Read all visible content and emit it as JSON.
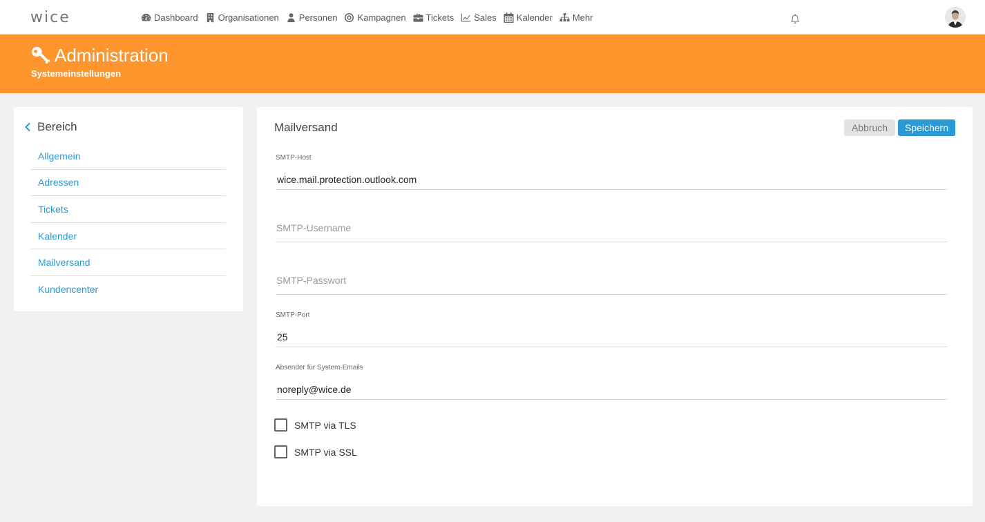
{
  "app": {
    "logo": "wice"
  },
  "nav": [
    {
      "label": "Dashboard",
      "icon": "dashboard-icon"
    },
    {
      "label": "Organisationen",
      "icon": "building-icon"
    },
    {
      "label": "Personen",
      "icon": "person-icon"
    },
    {
      "label": "Kampagnen",
      "icon": "target-icon"
    },
    {
      "label": "Tickets",
      "icon": "briefcase-icon"
    },
    {
      "label": "Sales",
      "icon": "line-chart-icon"
    },
    {
      "label": "Kalender",
      "icon": "calendar-icon"
    },
    {
      "label": "Mehr",
      "icon": "sitemap-icon"
    }
  ],
  "header": {
    "title": "Administration",
    "subtitle": "Systemeinstellungen",
    "icon": "key-icon",
    "color": "#ff952d"
  },
  "sidebar": {
    "heading": "Bereich",
    "items": [
      {
        "label": "Allgemein"
      },
      {
        "label": "Adressen"
      },
      {
        "label": "Tickets"
      },
      {
        "label": "Kalender"
      },
      {
        "label": "Mailversand"
      },
      {
        "label": "Kundencenter"
      }
    ]
  },
  "form": {
    "title": "Mailversand",
    "cancel_label": "Abbruch",
    "save_label": "Speichern",
    "smtp_host": {
      "label": "SMTP-Host",
      "value": "wice.mail.protection.outlook.com"
    },
    "smtp_username": {
      "placeholder": "SMTP-Username"
    },
    "smtp_password": {
      "placeholder": "SMTP-Passwort"
    },
    "smtp_port": {
      "label": "SMTP-Port",
      "value": "25"
    },
    "sender": {
      "label": "Absender für System-Emails",
      "value": "noreply@wice.de"
    },
    "tls": {
      "label": "SMTP via TLS",
      "checked": false
    },
    "ssl": {
      "label": "SMTP via SSL",
      "checked": false
    }
  },
  "colors": {
    "accent": "#2a9ad6",
    "brand": "#ff952d"
  }
}
